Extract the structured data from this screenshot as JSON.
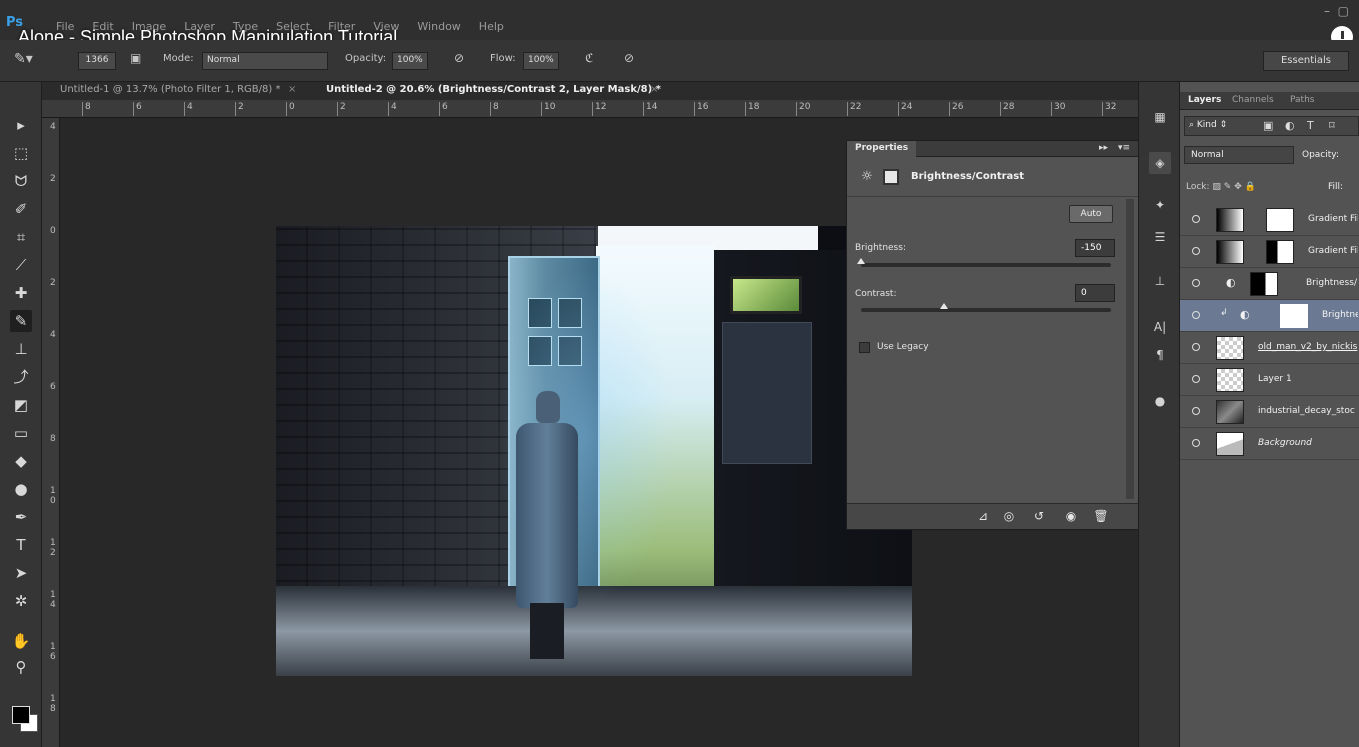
{
  "video": {
    "title": "Alone - Simple Photoshop Manipulation Tutorial"
  },
  "app": {
    "logo": "Ps",
    "menu": [
      "File",
      "Edit",
      "Image",
      "Layer",
      "Type",
      "Select",
      "Filter",
      "View",
      "Window",
      "Help"
    ]
  },
  "options": {
    "brush_size": "1366",
    "mode_label": "Mode:",
    "mode_value": "Normal",
    "opacity_label": "Opacity:",
    "opacity_value": "100%",
    "flow_label": "Flow:",
    "flow_value": "100%",
    "workspace": "Essentials"
  },
  "tabs": [
    {
      "label": "Untitled-1 @ 13.7% (Photo Filter 1, RGB/8) *",
      "active": false
    },
    {
      "label": "Untitled-2 @ 20.6% (Brightness/Contrast 2, Layer Mask/8) *",
      "active": true
    }
  ],
  "ruler_h": [
    "8",
    "6",
    "4",
    "2",
    "0",
    "2",
    "4",
    "6",
    "8",
    "10",
    "12",
    "14",
    "16",
    "18",
    "20",
    "22",
    "24",
    "26",
    "28",
    "30",
    "32"
  ],
  "ruler_v": [
    "4",
    "2",
    "0",
    "2",
    "4",
    "6",
    "8",
    "1 0",
    "1 2",
    "1 4",
    "1 6",
    "1 8"
  ],
  "properties": {
    "tab": "Properties",
    "title": "Brightness/Contrast",
    "auto_label": "Auto",
    "brightness_label": "Brightness:",
    "brightness_value": "-150",
    "brightness_level": -150,
    "contrast_label": "Contrast:",
    "contrast_value": "0",
    "contrast_level": 0,
    "use_legacy_label": "Use Legacy",
    "use_legacy_checked": false
  },
  "layers_panel": {
    "tabs": [
      "Layers",
      "Channels",
      "Paths"
    ],
    "kind_label": "Kind",
    "blend_mode": "Normal",
    "opacity_label": "Opacity:",
    "lock_label": "Lock:",
    "fill_label": "Fill:",
    "layers": [
      {
        "name": "Gradient Fil",
        "type": "gradient",
        "selected": false
      },
      {
        "name": "Gradient Fil",
        "type": "gradient",
        "selected": false
      },
      {
        "name": "Brightness/",
        "type": "adjustment",
        "selected": false
      },
      {
        "name": "Brightne",
        "type": "adjustment-clipped",
        "selected": true
      },
      {
        "name": "old_man_v2_by_nickis",
        "type": "pixel",
        "selected": false
      },
      {
        "name": "Layer 1",
        "type": "pixel",
        "selected": false
      },
      {
        "name": "industrial_decay_stoc",
        "type": "pixel",
        "selected": false
      },
      {
        "name": "Background",
        "type": "background",
        "selected": false
      }
    ]
  },
  "colors": {
    "accent": "#3aa0e8",
    "selected_layer": "#6b7a92",
    "panel": "#535353"
  }
}
